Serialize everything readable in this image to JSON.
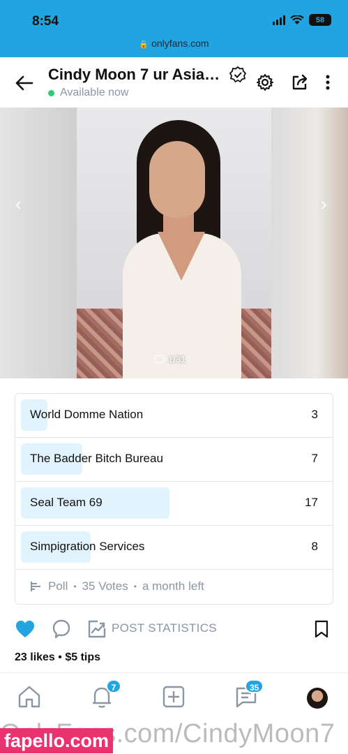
{
  "status_bar": {
    "time": "8:54",
    "battery": "58"
  },
  "browser": {
    "url": "onlyfans.com"
  },
  "header": {
    "title": "Cindy Moon 7 ur Asia…",
    "presence": "Available now"
  },
  "post": {
    "image_counter": "1/31",
    "image_watermark": "OnlyFans.com/cindymoon7"
  },
  "poll": {
    "options": [
      {
        "label": "World Domme Nation",
        "votes": "3",
        "share": 0.0857
      },
      {
        "label": "The Badder Bitch Bureau",
        "votes": "7",
        "share": 0.2
      },
      {
        "label": "Seal Team 69",
        "votes": "17",
        "share": 0.4857
      },
      {
        "label": "Simpigration Services",
        "votes": "8",
        "share": 0.2286
      }
    ],
    "footer": {
      "kind": "Poll",
      "votes": "35 Votes",
      "remaining": "a month left"
    }
  },
  "actions": {
    "statistics_label": "POST STATISTICS"
  },
  "engagement": {
    "likes": "23 likes",
    "tips": "$5 tips"
  },
  "nav": {
    "notifications_badge": "7",
    "messages_badge": "35"
  },
  "watermark": {
    "logo": "fapello.com",
    "text": "OnlyFans.com/CindyMoon7"
  },
  "colors": {
    "brand": "#21a4e0",
    "poll_fill": "#e1f3fc",
    "muted": "#8a96a3",
    "online": "#2ecc71"
  }
}
